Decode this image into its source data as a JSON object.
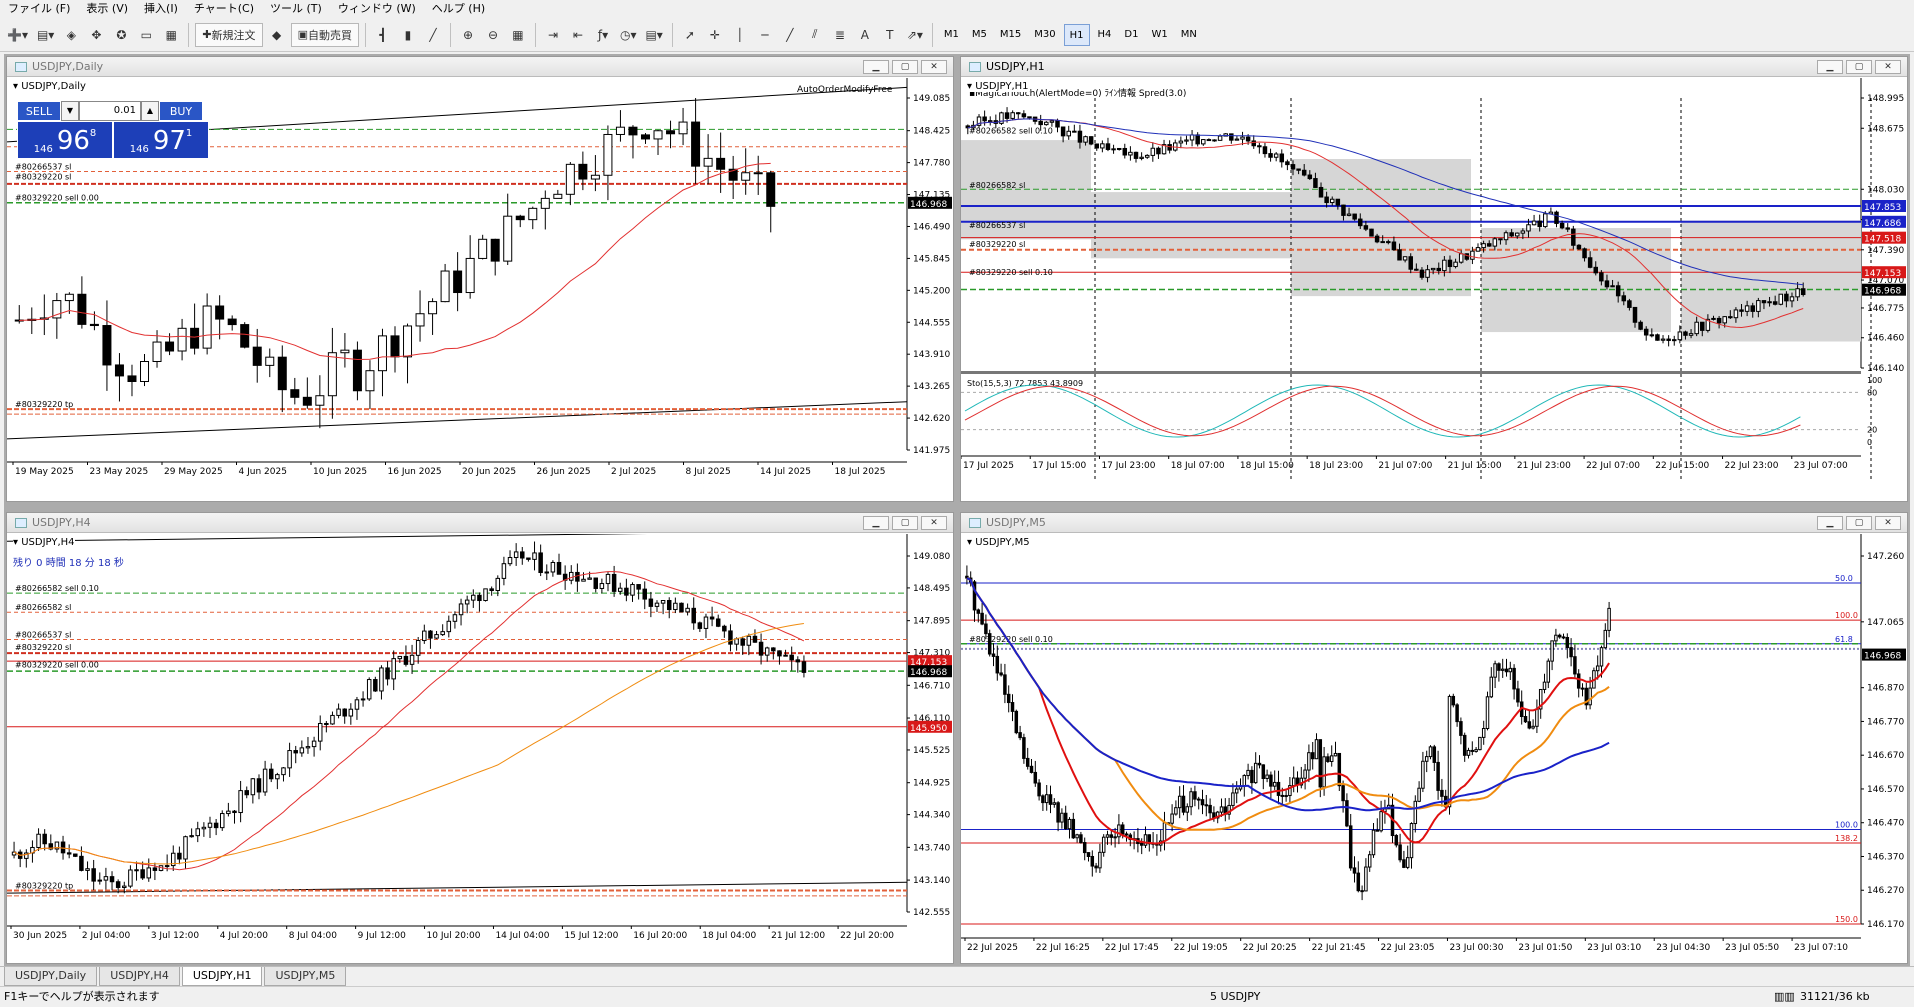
{
  "menu": [
    "ファイル (F)",
    "表示 (V)",
    "挿入(I)",
    "チャート(C)",
    "ツール (T)",
    "ウィンドウ (W)",
    "ヘルプ (H)"
  ],
  "toolbar": {
    "new_order": "新規注文",
    "auto_trade": "自動売買",
    "timeframes": [
      "M1",
      "M5",
      "M15",
      "M30",
      "H1",
      "H4",
      "D1",
      "W1",
      "MN"
    ],
    "active_timeframe": "H1"
  },
  "windows": {
    "daily": {
      "title": "USDJPY,Daily",
      "symbol": "USDJPY,Daily",
      "ea_label": "AutoOrderModifyFree",
      "trade_panel": {
        "sell": "SELL",
        "buy": "BUY",
        "lot": "0.01",
        "bid_prefix": "146",
        "bid_big": "96",
        "bid_sup": "8",
        "ask_prefix": "146",
        "ask_big": "97",
        "ask_sup": "1"
      },
      "price_ticks": [
        "149.085",
        "148.425",
        "147.780",
        "147.135",
        "146.490",
        "145.845",
        "145.200",
        "144.555",
        "143.910",
        "143.265",
        "142.620",
        "141.975"
      ],
      "date_ticks": [
        "19 May 2025",
        "23 May 2025",
        "29 May 2025",
        "4 Jun 2025",
        "10 Jun 2025",
        "16 Jun 2025",
        "20 Jun 2025",
        "26 Jun 2025",
        "2 Jul 2025",
        "8 Jul 2025",
        "14 Jul 2025",
        "18 Jul 2025"
      ],
      "current_price": "146.968",
      "order_labels": [
        "#80266537 sl",
        "#80329220 sl",
        "#80329220 sell 0.00",
        "#80329220 tp"
      ]
    },
    "h1": {
      "title": "USDJPY,H1",
      "symbol": "USDJPY,H1",
      "indicator_line": "MagicalTouch(AlertMode=0) ﾗｲﾝ情報 Spred(3.0)",
      "price_ticks": [
        "148.995",
        "148.675",
        "148.030",
        "147.710",
        "147.390",
        "147.070",
        "146.775",
        "146.460",
        "146.140"
      ],
      "price_tags": [
        {
          "label": "147.853",
          "color": "#1a22c8"
        },
        {
          "label": "147.686",
          "color": "#1a22c8"
        },
        {
          "label": "147.518",
          "color": "#d81818"
        },
        {
          "label": "147.153",
          "color": "#d81818"
        },
        {
          "label": "146.968",
          "color": "#000000"
        }
      ],
      "current_price": "146.968",
      "order_labels": [
        "#80266582 sell 0.10",
        "#80266582 sl",
        "#80266537 sl",
        "#80329220 sl",
        "#80329220 sell 0.10"
      ],
      "stoch_label": "Sto(15,5,3) 72.7853 43.8909",
      "stoch_levels": [
        "100",
        "80",
        "20",
        "0"
      ],
      "date_ticks": [
        "17 Jul 2025",
        "17 Jul 15:00",
        "17 Jul 23:00",
        "18 Jul 07:00",
        "18 Jul 15:00",
        "18 Jul 23:00",
        "21 Jul 07:00",
        "21 Jul 15:00",
        "21 Jul 23:00",
        "22 Jul 07:00",
        "22 Jul 15:00",
        "22 Jul 23:00",
        "23 Jul 07:00"
      ]
    },
    "h4": {
      "title": "USDJPY,H4",
      "symbol": "USDJPY,H4",
      "countdown": "残り 0 時間 18 分 18 秒",
      "price_ticks": [
        "149.080",
        "148.495",
        "147.895",
        "147.310",
        "146.710",
        "146.110",
        "145.525",
        "144.925",
        "144.340",
        "143.740",
        "143.140",
        "142.555"
      ],
      "price_tags": [
        {
          "label": "147.153",
          "color": "#d81818"
        },
        {
          "label": "146.968",
          "color": "#000000"
        },
        {
          "label": "145.950",
          "color": "#d81818"
        }
      ],
      "current_price": "146.968",
      "order_labels": [
        "#80266582 sell 0.10",
        "#80266582 sl",
        "#80266537 sl",
        "#80329220 sl",
        "#80329220 sell 0.00",
        "#80329220 tp"
      ],
      "date_ticks": [
        "30 Jun 2025",
        "2 Jul 04:00",
        "3 Jul 12:00",
        "4 Jul 20:00",
        "8 Jul 04:00",
        "9 Jul 12:00",
        "10 Jul 20:00",
        "14 Jul 04:00",
        "15 Jul 12:00",
        "16 Jul 20:00",
        "18 Jul 04:00",
        "21 Jul 12:00",
        "22 Jul 20:00"
      ]
    },
    "m5": {
      "title": "USDJPY,M5",
      "symbol": "USDJPY,M5",
      "price_ticks": [
        "147.260",
        "147.065",
        "146.870",
        "146.770",
        "146.670",
        "146.570",
        "146.470",
        "146.370",
        "146.270",
        "146.170"
      ],
      "current_price": "146.968",
      "fib_labels": [
        "50.0",
        "100.0",
        "61.8",
        "100.0",
        "138.2",
        "150.0"
      ],
      "order_labels": [
        "#80329220 sell 0.10"
      ],
      "date_ticks": [
        "22 Jul 2025",
        "22 Jul 16:25",
        "22 Jul 17:45",
        "22 Jul 19:05",
        "22 Jul 20:25",
        "22 Jul 21:45",
        "22 Jul 23:05",
        "23 Jul 00:30",
        "23 Jul 01:50",
        "23 Jul 03:10",
        "23 Jul 04:30",
        "23 Jul 05:50",
        "23 Jul 07:10"
      ]
    }
  },
  "tabs": [
    "USDJPY,Daily",
    "USDJPY,H4",
    "USDJPY,H1",
    "USDJPY,M5"
  ],
  "active_tab": "USDJPY,H1",
  "status": {
    "help": "F1キーでヘルプが表示されます",
    "profile": "5 USDJPY",
    "traffic": "31121/36 kb"
  }
}
